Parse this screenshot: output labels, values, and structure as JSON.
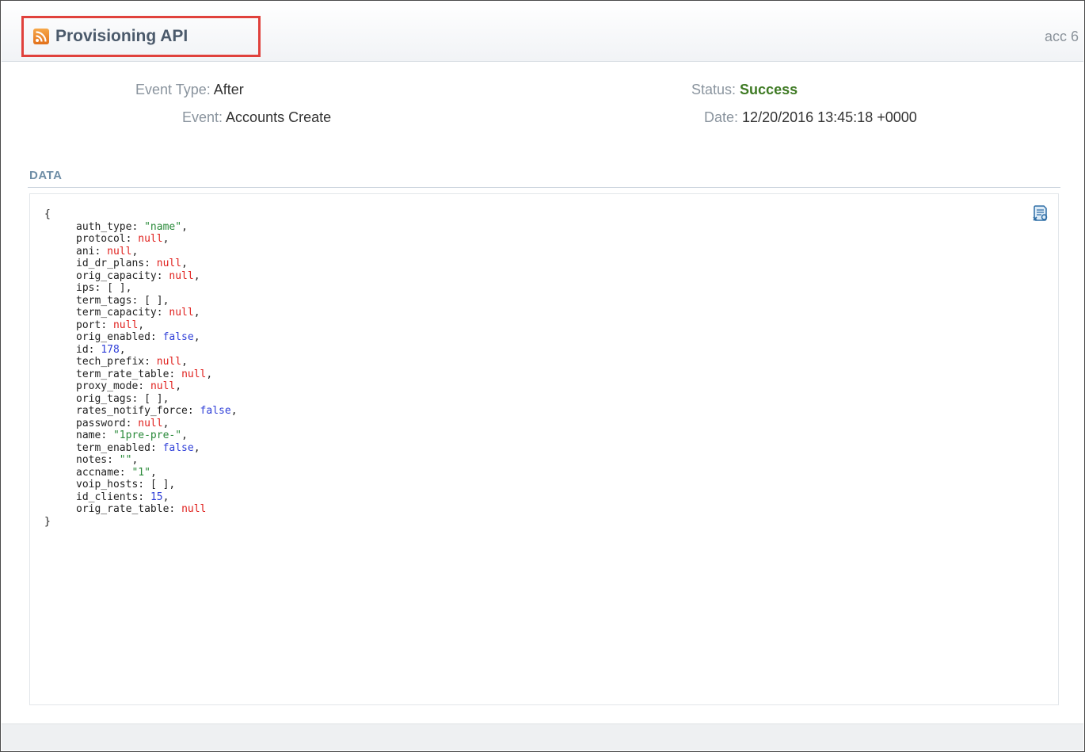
{
  "header": {
    "title": "Provisioning API",
    "right_text": "acc 6",
    "icon": "rss-icon"
  },
  "details": {
    "event_type_label": "Event Type:",
    "event_type_value": "After",
    "event_label": "Event:",
    "event_value": "Accounts Create",
    "status_label": "Status:",
    "status_value": "Success",
    "date_label": "Date:",
    "date_value": "12/20/2016 13:45:18 +0000"
  },
  "data_section": {
    "label": "DATA",
    "open_brace": "{",
    "close_brace": "}",
    "copy_icon": "json-copy-icon",
    "fields": [
      {
        "key": "auth_type",
        "value": "\"name\"",
        "type": "string"
      },
      {
        "key": "protocol",
        "value": "null",
        "type": "null"
      },
      {
        "key": "ani",
        "value": "null",
        "type": "null"
      },
      {
        "key": "id_dr_plans",
        "value": "null",
        "type": "null"
      },
      {
        "key": "orig_capacity",
        "value": "null",
        "type": "null"
      },
      {
        "key": "ips",
        "value": "[ ]",
        "type": "array"
      },
      {
        "key": "term_tags",
        "value": "[ ]",
        "type": "array"
      },
      {
        "key": "term_capacity",
        "value": "null",
        "type": "null"
      },
      {
        "key": "port",
        "value": "null",
        "type": "null"
      },
      {
        "key": "orig_enabled",
        "value": "false",
        "type": "bool"
      },
      {
        "key": "id",
        "value": "178",
        "type": "num"
      },
      {
        "key": "tech_prefix",
        "value": "null",
        "type": "null"
      },
      {
        "key": "term_rate_table",
        "value": "null",
        "type": "null"
      },
      {
        "key": "proxy_mode",
        "value": "null",
        "type": "null"
      },
      {
        "key": "orig_tags",
        "value": "[ ]",
        "type": "array"
      },
      {
        "key": "rates_notify_force",
        "value": "false",
        "type": "bool"
      },
      {
        "key": "password",
        "value": "null",
        "type": "null"
      },
      {
        "key": "name",
        "value": "\"1pre-pre-\"",
        "type": "string"
      },
      {
        "key": "term_enabled",
        "value": "false",
        "type": "bool"
      },
      {
        "key": "notes",
        "value": "\"\"",
        "type": "string"
      },
      {
        "key": "accname",
        "value": "\"1\"",
        "type": "string"
      },
      {
        "key": "voip_hosts",
        "value": "[ ]",
        "type": "array"
      },
      {
        "key": "id_clients",
        "value": "15",
        "type": "num"
      },
      {
        "key": "orig_rate_table",
        "value": "null",
        "type": "null"
      }
    ]
  },
  "colors": {
    "highlight_border": "#e0413c",
    "status_success": "#3e7a23",
    "string_value": "#2a8a3a",
    "null_value": "#e0201d",
    "bool_value": "#2f3fd8"
  }
}
